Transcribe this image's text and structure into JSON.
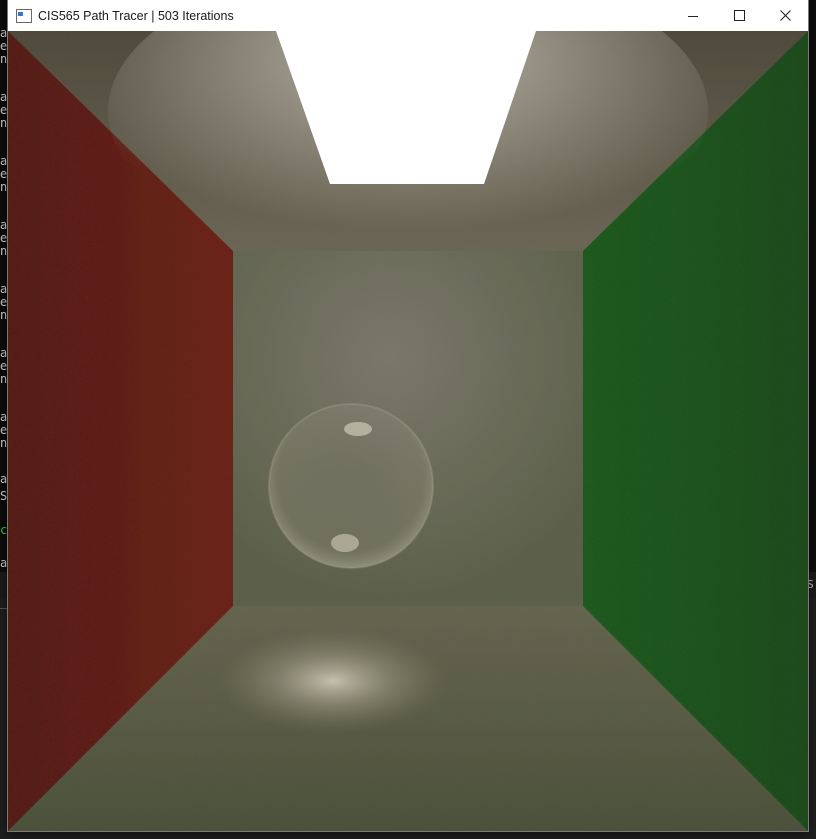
{
  "window": {
    "title": "CIS565 Path Tracer | 503 Iterations",
    "controls": {
      "minimize_icon": "minimize-icon",
      "maximize_icon": "maximize-icon",
      "close_icon": "close-icon"
    }
  },
  "console": {
    "glyphs_white": [
      "a",
      "e",
      "n",
      "a",
      "e",
      "n",
      "a",
      "e",
      "n",
      "a",
      "e",
      "n",
      "a",
      "e",
      "n",
      "a",
      "e",
      "n",
      "a",
      "e",
      "n",
      "a",
      "e",
      "n",
      "0"
    ],
    "glyph_gray": "S",
    "glyph_green": "c",
    "glyph_bar": "a",
    "bar_edge": "S"
  },
  "scene": {
    "colors": {
      "left_wall": "#6b2418",
      "right_wall": "#1f5a1f",
      "back_wall": "#6c6a58",
      "ceiling": "#5a5444",
      "floor": "#5a5e45",
      "light": "#ffffff"
    }
  }
}
